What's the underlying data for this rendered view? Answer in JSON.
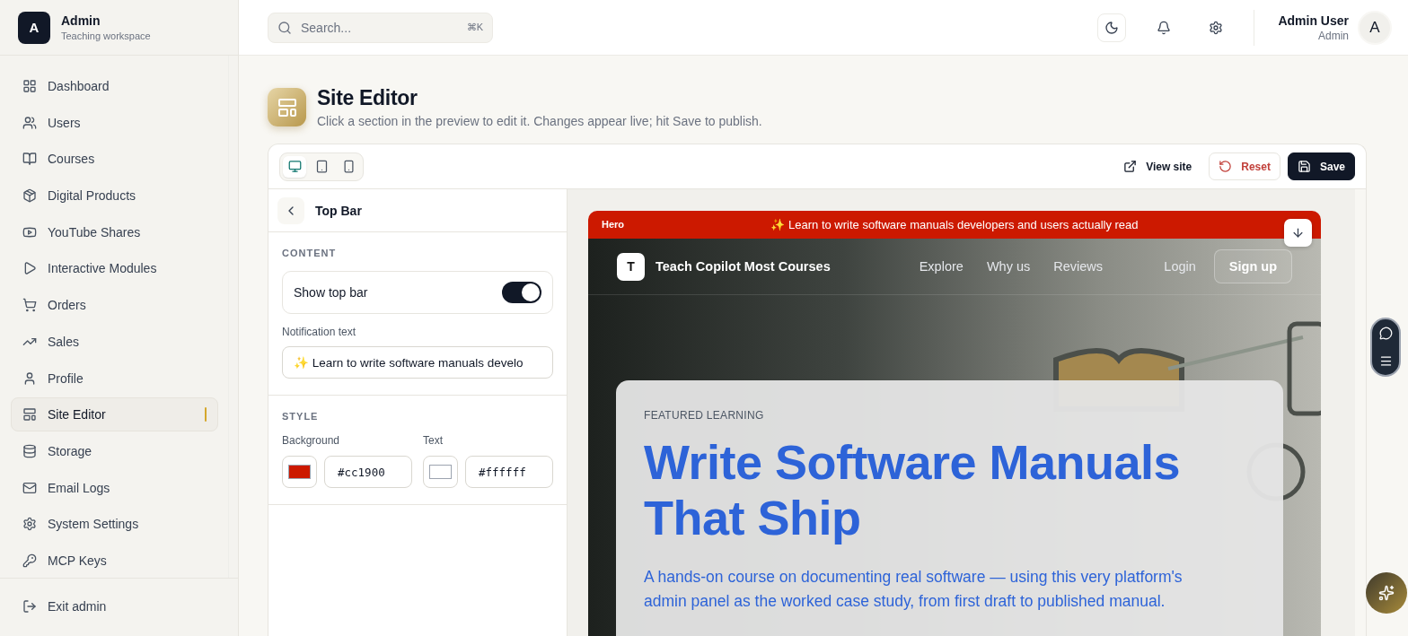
{
  "workspace": {
    "logo_letter": "A",
    "name": "Admin",
    "subtitle": "Teaching workspace"
  },
  "sidebar": {
    "items": [
      {
        "label": "Dashboard",
        "selected": false
      },
      {
        "label": "Users",
        "selected": false
      },
      {
        "label": "Courses",
        "selected": false
      },
      {
        "label": "Digital Products",
        "selected": false
      },
      {
        "label": "YouTube Shares",
        "selected": false
      },
      {
        "label": "Interactive Modules",
        "selected": false
      },
      {
        "label": "Orders",
        "selected": false
      },
      {
        "label": "Sales",
        "selected": false
      },
      {
        "label": "Profile",
        "selected": false
      },
      {
        "label": "Site Editor",
        "selected": true
      },
      {
        "label": "Storage",
        "selected": false
      },
      {
        "label": "Email Logs",
        "selected": false
      },
      {
        "label": "System Settings",
        "selected": false
      },
      {
        "label": "MCP Keys",
        "selected": false
      }
    ],
    "footer": {
      "label": "Exit admin"
    }
  },
  "header": {
    "search": {
      "placeholder": "Search...",
      "shortcut": "⌘K"
    },
    "user": {
      "name": "Admin User",
      "role": "Admin",
      "avatar_letter": "A"
    }
  },
  "page": {
    "title": "Site Editor",
    "subtitle": "Click a section in the preview to edit it. Changes appear live; hit Save to publish."
  },
  "toolbar": {
    "devices": [
      {
        "kind": "desktop",
        "selected": true
      },
      {
        "kind": "tablet",
        "selected": false
      },
      {
        "kind": "phone",
        "selected": false
      }
    ],
    "buttons": [
      {
        "kind": "link",
        "label": "View site"
      },
      {
        "kind": "danger",
        "label": "Reset"
      },
      {
        "kind": "primary",
        "label": "Save"
      }
    ]
  },
  "panel": {
    "title": "Top Bar",
    "content_heading": "CONTENT",
    "toggle": {
      "label": "Show top bar",
      "on": true
    },
    "notification": {
      "label": "Notification text",
      "value": "✨ Learn to write software manuals develo"
    },
    "style_heading": "STYLE",
    "colors": [
      {
        "label": "Background",
        "color": "#cc1900",
        "value": "#cc1900"
      },
      {
        "label": "Text",
        "color": "#ffffff",
        "value": "#ffffff"
      }
    ]
  },
  "preview": {
    "section_label": "Hero",
    "top_bar_text": "✨ Learn to write software manuals developers and users actually read",
    "brand_letter": "T",
    "brand": "Teach Copilot Most Courses",
    "nav": [
      "Explore",
      "Why us",
      "Reviews"
    ],
    "login": "Login",
    "signup": "Sign up",
    "eyebrow": "FEATURED LEARNING",
    "headline": "Write Software Manuals That Ship",
    "lead": "A hands-on course on documenting real software — using this very platform's admin panel as the worked case study, from first draft to published manual."
  }
}
